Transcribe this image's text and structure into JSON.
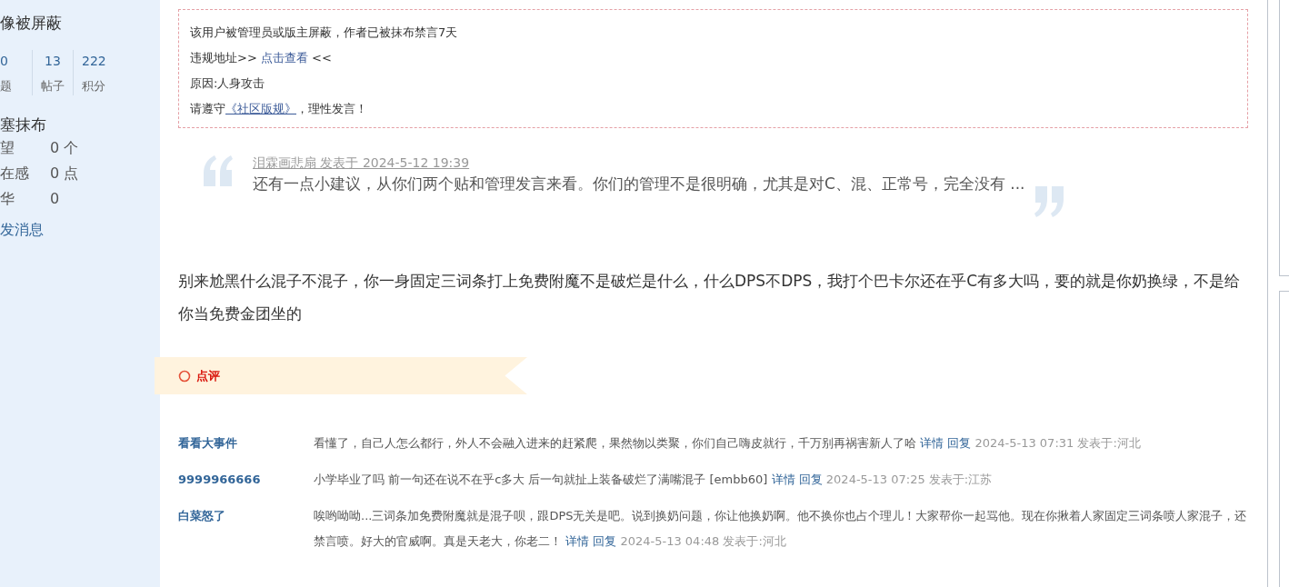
{
  "sidebar": {
    "title": "像被屏蔽",
    "stats": [
      {
        "value": "0",
        "label": "题"
      },
      {
        "value": "13",
        "label": "帖子"
      },
      {
        "value": "222",
        "label": "积分"
      }
    ],
    "group_title": "塞抹布",
    "fields": [
      {
        "label": "望",
        "value": "0 个"
      },
      {
        "label": "在感",
        "value": "0 点"
      },
      {
        "label": "华",
        "value": "0"
      }
    ],
    "message_link": "发消息"
  },
  "notice": {
    "line_1": "该用户被管理员或版主屏蔽，作者已被抹布禁言7天",
    "line_2_prefix": "违规地址>> ",
    "line_2_link": "点击查看",
    "line_2_suffix": " <<",
    "line_3": "原因:人身攻击",
    "line_4_prefix": "请遵守",
    "line_4_link": "《社区版规》",
    "line_4_suffix": "，理性发言！"
  },
  "quote": {
    "author_line": "泪霖画悲扇 发表于 2024-5-12 19:39",
    "text": "还有一点小建议，从你们两个贴和管理发言来看。你们的管理不是很明确，尤其是对C、混、正常号，完全没有 ..."
  },
  "post_text": "别来尬黑什么混子不混子，你一身固定三词条打上免费附魔不是破烂是什么，什么DPS不DPS，我打个巴卡尔还在乎C有多大吗，要的就是你奶换绿，不是给你当免费金团坐的",
  "comments_header": "点评",
  "comments": [
    {
      "author": "看看大事件",
      "text": "看懂了，自己人怎么都行，外人不会融入进来的赶紧爬，果然物以类聚，你们自己嗨皮就行，千万别再祸害新人了哈",
      "links": [
        "详情",
        "回复"
      ],
      "meta": "2024-5-13 07:31 发表于:河北"
    },
    {
      "author": "9999966666",
      "text": "小学毕业了吗 前一句还在说不在乎c多大 后一句就扯上装备破烂了满嘴混子 [embb60]",
      "links": [
        "详情",
        "回复"
      ],
      "meta": "2024-5-13 07:25 发表于:江苏"
    },
    {
      "author": "白菜怒了",
      "text": "唉哟呦呦...三词条加免费附魔就是混子呗，跟DPS无关是吧。说到换奶问题，你让他换奶啊。他不换你也占个理儿！大家帮你一起骂他。现在你揪着人家固定三词条喷人家混子，还禁言喷。好大的官威啊。真是天老大，你老二！",
      "links": [
        "详情",
        "回复"
      ],
      "meta": "2024-5-13 04:48 发表于:河北"
    }
  ]
}
